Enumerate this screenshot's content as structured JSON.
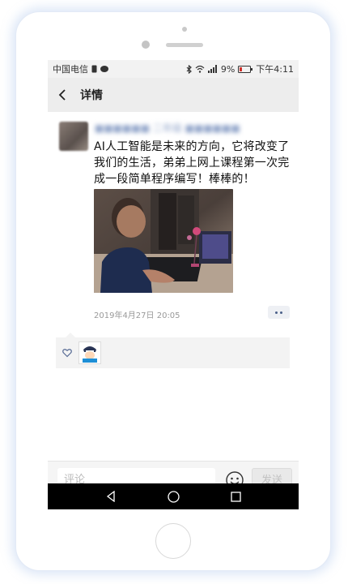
{
  "status_bar": {
    "carrier": "中国电信",
    "battery_percent": "9%",
    "time": "下午4:11"
  },
  "nav": {
    "title": "详情",
    "back_icon": "chevron-left-icon"
  },
  "post": {
    "username": "■■■■■■ 二年级 ■■■■■■",
    "text": "AI人工智能是未来的方向，它将改变了我们的生活，弟弟上网上课程第一次完成一段简单程序编写！棒棒的！",
    "timestamp": "2019年4月27日 20:05"
  },
  "likes": {
    "heart_icon": "heart-outline-icon"
  },
  "comment_bar": {
    "placeholder": "评论",
    "send_label": "发送"
  },
  "colors": {
    "accent_link": "#576b95",
    "nav_bg": "#ededed",
    "sys_nav_bg": "#000000"
  }
}
